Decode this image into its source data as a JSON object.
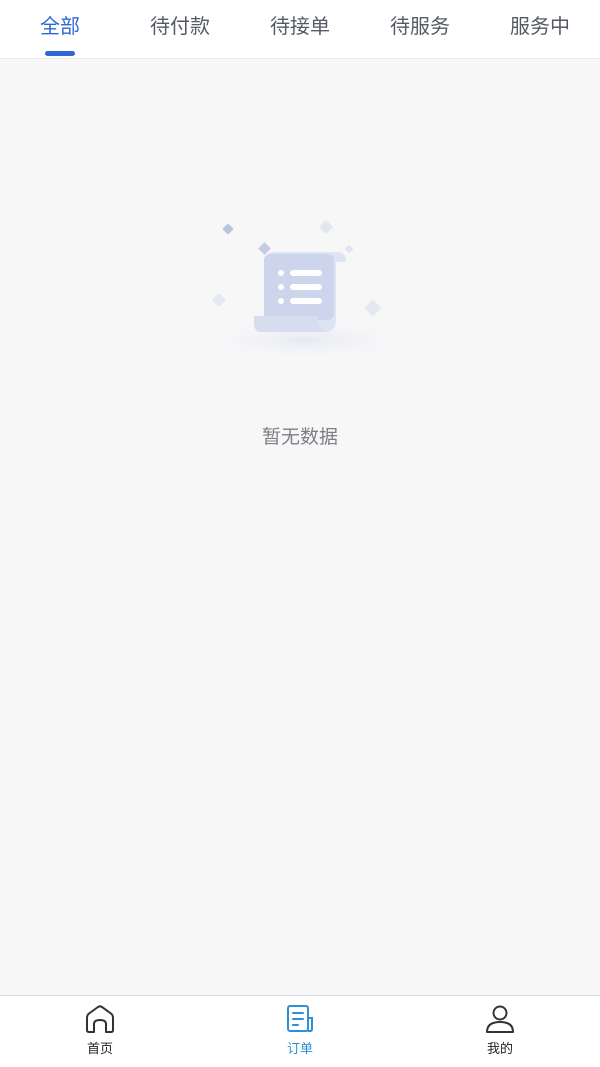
{
  "tabs": [
    {
      "label": "全部",
      "active": true
    },
    {
      "label": "待付款",
      "active": false
    },
    {
      "label": "待接单",
      "active": false
    },
    {
      "label": "待服务",
      "active": false
    },
    {
      "label": "服务中",
      "active": false
    }
  ],
  "empty_state": {
    "icon": "document-list-icon",
    "text": "暂无数据"
  },
  "bottom_nav": [
    {
      "label": "首页",
      "icon": "home-icon",
      "active": false
    },
    {
      "label": "订单",
      "icon": "order-icon",
      "active": true
    },
    {
      "label": "我的",
      "icon": "user-icon",
      "active": false
    }
  ],
  "colors": {
    "accent": "#2f68d6",
    "nav_active": "#2f8fd6",
    "background": "#f7f7f8"
  }
}
